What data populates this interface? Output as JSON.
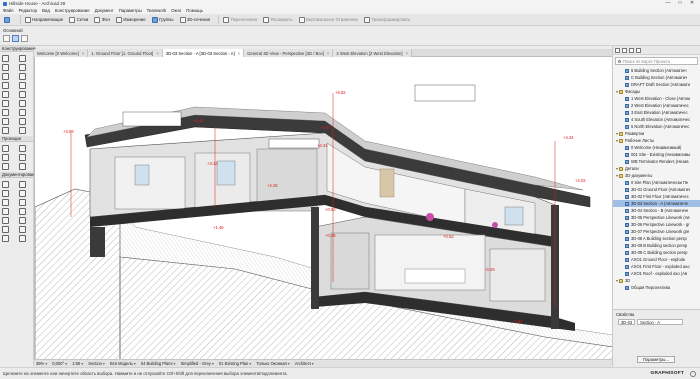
{
  "window": {
    "title": "Hillside House - Archicad 28",
    "controls": [
      "—",
      "□",
      "✕"
    ]
  },
  "menu": [
    "Файл",
    "Редактор",
    "Вид",
    "Конструирование",
    "Документ",
    "Параметры",
    "Teamwork",
    "Окно",
    "Помощь"
  ],
  "toolbar": {
    "items": [
      {
        "label": "",
        "icon": "arrow-select-icon"
      },
      {
        "label": "Направляющие",
        "icon": "guides-icon"
      },
      {
        "label": "Сетки",
        "icon": "grid-icon"
      },
      {
        "label": "Фон",
        "icon": "background-icon"
      },
      {
        "label": "Измерение",
        "icon": "measure-icon"
      },
      {
        "label": "Группы",
        "icon": "groups-icon"
      },
      {
        "label": "3D-сечения",
        "icon": "3d-section-icon"
      },
      {
        "label": "Пересечения",
        "icon": "intersections-icon",
        "dim": true
      },
      {
        "label": "Расширить",
        "icon": "extend-icon",
        "dim": true
      },
      {
        "label": "Вертикальное Отражение",
        "icon": "mirror-icon",
        "dim": true
      },
      {
        "label": "Трансформировать",
        "icon": "transform-icon",
        "dim": true
      }
    ]
  },
  "infobar": {
    "label": "Основной"
  },
  "tabs": [
    {
      "label": "Welcome [0 Welcome]",
      "active": false
    },
    {
      "label": "1. Ground Floor [1. Ground Floor]",
      "active": false
    },
    {
      "label": "3D-03 Section - A [3D-03 Section - A]",
      "active": true
    },
    {
      "label": "General 3D View - Perspective [3D / Все]",
      "active": false
    },
    {
      "label": "2 West Elevation [2 West Elevation]",
      "active": false
    }
  ],
  "left_palette": {
    "sections": [
      {
        "title": "Конструирование",
        "tool_count": 26
      },
      {
        "title": "Проекции",
        "tool_count": 6
      },
      {
        "title": "Документирование",
        "tool_count": 22
      }
    ]
  },
  "viewport": {
    "level_markers": [
      "+6.82",
      "+4.46",
      "+4.97",
      "+4.31",
      "+3.68",
      "+3.13",
      "+2.28",
      "+1.46",
      "+0.92",
      "+0.52",
      "+0.36",
      "-0.29",
      "-0.81",
      "+4.34",
      "+2.02"
    ]
  },
  "navigator": {
    "search_placeholder": "Поиск по Карте Проекта",
    "items": [
      {
        "label": "6 Building Section (Автоматич",
        "indent": 3,
        "type": "view"
      },
      {
        "label": "C Building Section (Автоматич",
        "indent": 3,
        "type": "view"
      },
      {
        "label": "DRAFT Draft Section (Автомати",
        "indent": 3,
        "type": "view"
      },
      {
        "label": "Фасады",
        "indent": 1,
        "type": "folder"
      },
      {
        "label": "1 West Elevation - Close (Автом",
        "indent": 3,
        "type": "view"
      },
      {
        "label": "2 West Elevation (Автоматичес",
        "indent": 3,
        "type": "view"
      },
      {
        "label": "3 East Elevation (Автоматичес",
        "indent": 3,
        "type": "view"
      },
      {
        "label": "4 South Elevation (Автоматичес",
        "indent": 3,
        "type": "view"
      },
      {
        "label": "5 North Elevation (Автоматичес",
        "indent": 3,
        "type": "view"
      },
      {
        "label": "Развертки",
        "indent": 1,
        "type": "folder"
      },
      {
        "label": "Рабочие Листы",
        "indent": 1,
        "type": "folder"
      },
      {
        "label": "0 Welcome (Независимый)",
        "indent": 3,
        "type": "view"
      },
      {
        "label": "001 Site - Existing (Независимы",
        "indent": 3,
        "type": "view"
      },
      {
        "label": "WB Terminator Renders (Незав",
        "indent": 3,
        "type": "view"
      },
      {
        "label": "Детали",
        "indent": 1,
        "type": "folder"
      },
      {
        "label": "3D-документы",
        "indent": 1,
        "type": "folder"
      },
      {
        "label": "0 Site Plan (Автоматически Пе",
        "indent": 3,
        "type": "view"
      },
      {
        "label": "3D-01 Ground Floor (Автоматич",
        "indent": 3,
        "type": "view"
      },
      {
        "label": "3D-02 First Floor (Автоматичес",
        "indent": 3,
        "type": "view"
      },
      {
        "label": "3D-03 Section - A (Автоматиче",
        "indent": 3,
        "type": "view",
        "selected": true
      },
      {
        "label": "3D-04 Section - B (Автоматиче",
        "indent": 3,
        "type": "view"
      },
      {
        "label": "3D-05 Perspective Linework (Ав",
        "indent": 3,
        "type": "view"
      },
      {
        "label": "3D-06 Perspective Linework - gr",
        "indent": 3,
        "type": "view"
      },
      {
        "label": "3D-07 Perspective Linework gre",
        "indent": 3,
        "type": "view"
      },
      {
        "label": "3D-08 A Building section persp",
        "indent": 3,
        "type": "view"
      },
      {
        "label": "3D-09 B Building section persp",
        "indent": 3,
        "type": "view"
      },
      {
        "label": "3D-09 C Building section persp",
        "indent": 3,
        "type": "view"
      },
      {
        "label": "AXO1 Ground Floor - explode",
        "indent": 3,
        "type": "view"
      },
      {
        "label": "AXO1 First Floor - exploded axo",
        "indent": 3,
        "type": "view"
      },
      {
        "label": "AXO1 Roof - exploded axo (Ав",
        "indent": 3,
        "type": "view"
      },
      {
        "label": "3D",
        "indent": 1,
        "type": "folder"
      },
      {
        "label": "Общая Перспектива",
        "indent": 3,
        "type": "view"
      }
    ],
    "properties_title": "Свойства",
    "prop_id": "3D-03",
    "prop_name": "Section - A",
    "params_button": "Параметры..."
  },
  "statusbar": {
    "items": [
      "39%",
      "0,000°",
      "1:50",
      "Section",
      "Вся Модель",
      "04 Building Plans",
      "Simplified - Grey",
      "01 Existing Plan",
      "Только Оконная",
      "Architect"
    ]
  },
  "hint": "Щелкните на элементе или начертите область выбора. Нажмите и не отпускайте Ctrl+Shift для переключения выбора элемента/подэлемента.",
  "brand": "GRAPHISOFT"
}
